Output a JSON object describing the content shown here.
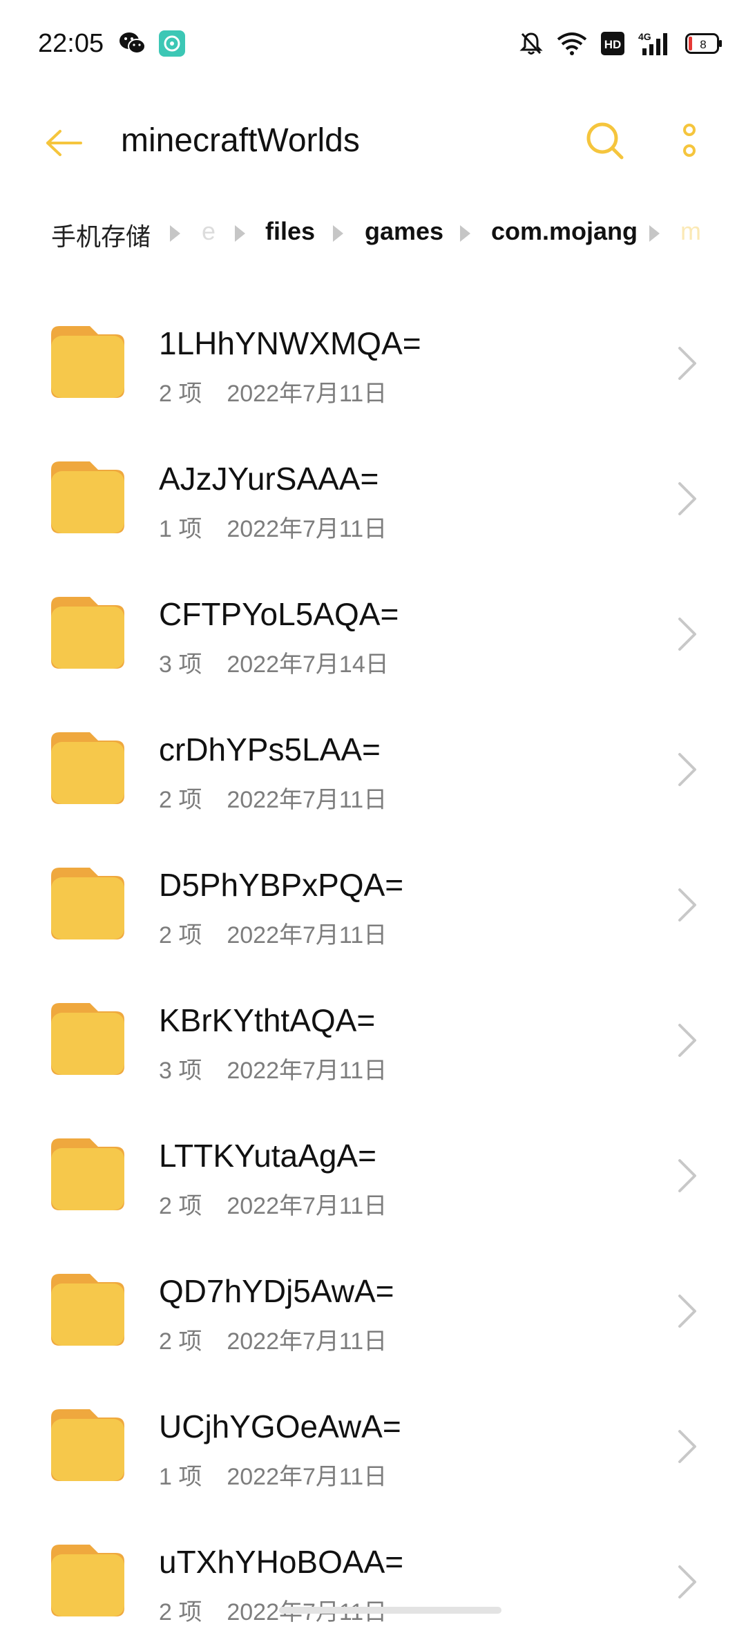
{
  "status_bar": {
    "time": "22:05",
    "network": "4G",
    "hd": "HD",
    "battery": "8"
  },
  "header": {
    "title": "minecraftWorlds"
  },
  "breadcrumb": {
    "items": [
      "手机存储",
      "e",
      "files",
      "games",
      "com.mojang",
      "m"
    ]
  },
  "files": [
    {
      "name": "1LHhYNWXMQA=",
      "count": "2 项",
      "date": "2022年7月11日"
    },
    {
      "name": "AJzJYurSAAA=",
      "count": "1 项",
      "date": "2022年7月11日"
    },
    {
      "name": "CFTPYoL5AQA=",
      "count": "3 项",
      "date": "2022年7月14日"
    },
    {
      "name": "crDhYPs5LAA=",
      "count": "2 项",
      "date": "2022年7月11日"
    },
    {
      "name": "D5PhYBPxPQA=",
      "count": "2 项",
      "date": "2022年7月11日"
    },
    {
      "name": "KBrKYthtAQA=",
      "count": "3 项",
      "date": "2022年7月11日"
    },
    {
      "name": "LTTKYutaAgA=",
      "count": "2 项",
      "date": "2022年7月11日"
    },
    {
      "name": "QD7hYDj5AwA=",
      "count": "2 项",
      "date": "2022年7月11日"
    },
    {
      "name": "UCjhYGOeAwA=",
      "count": "1 项",
      "date": "2022年7月11日"
    },
    {
      "name": "uTXhYHoBOAA=",
      "count": "2 项",
      "date": "2022年7月11日"
    }
  ],
  "colors": {
    "accent": "#F5C53D",
    "folder": "#F6C84B",
    "folder_tab": "#EFA83E"
  },
  "icons": {
    "back": "arrow-left-icon",
    "search": "search-icon",
    "more": "more-vertical-icon",
    "folder": "folder-icon",
    "chevron": "chevron-right-icon"
  }
}
